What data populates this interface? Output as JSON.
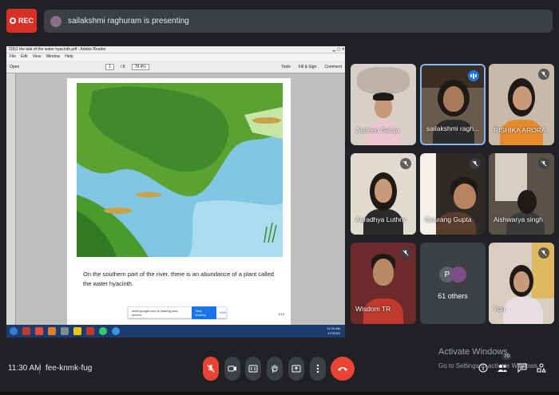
{
  "topbar": {
    "rec_label": "REC",
    "presenting_text": "sailakshmi raghuram is presenting"
  },
  "shared_screen": {
    "window_title": "2(8)1 the tale of the water hyacinth.pdf - Adobe Reader",
    "menu": [
      "File",
      "Edit",
      "View",
      "Window",
      "Help"
    ],
    "page_field": "1",
    "page_total": "/ 8",
    "zoom": "78.4%",
    "toolbar_right": [
      "Tools",
      "Fill & Sign",
      "Comment"
    ],
    "open_label": "Open",
    "caption": "On the southern part of the river, there is an abundance of a plant called the water hyacinth.",
    "page_number": "3/18",
    "share_text": "meet.google.com is sharing your screen.",
    "stop_sharing": "Stop sharing",
    "hide": "Hide",
    "tray_time": "11:30 AM",
    "tray_date": "1/7/2021"
  },
  "participants": [
    {
      "name": "Jasleen Saluja",
      "muted": false,
      "speaking": false
    },
    {
      "name": "sailakshmi ragh...",
      "muted": false,
      "speaking": true
    },
    {
      "name": "RISHIKA ARORA",
      "muted": true,
      "speaking": false
    },
    {
      "name": "Aaradhya Luthra",
      "muted": true,
      "speaking": false
    },
    {
      "name": "Gaurang Gupta",
      "muted": true,
      "speaking": false
    },
    {
      "name": "Aishwarya singh",
      "muted": true,
      "speaking": false
    },
    {
      "name": "Wisdom TR",
      "muted": true,
      "speaking": false
    },
    {
      "name": "61 others",
      "muted": false,
      "speaking": false
    },
    {
      "name": "You",
      "muted": true,
      "speaking": false
    }
  ],
  "others_avatar_letter": "P",
  "bottombar": {
    "time": "11:30 AM",
    "meeting_code": "fee-knmk-fug",
    "activate_title": "Activate Windows",
    "activate_sub": "Go to Settings to activate Windows.",
    "participants_badge": "70"
  },
  "colors": {
    "rec": "#d93025",
    "mic_off": "#ea4335",
    "speaking": "#1a73e8",
    "background": "#202124",
    "tile": "#3c4043"
  },
  "icons": [
    "mic-off-icon",
    "camera-icon",
    "captions-icon",
    "raise-hand-icon",
    "present-icon",
    "more-icon",
    "end-call-icon",
    "info-icon",
    "people-icon",
    "chat-icon",
    "activities-icon"
  ]
}
